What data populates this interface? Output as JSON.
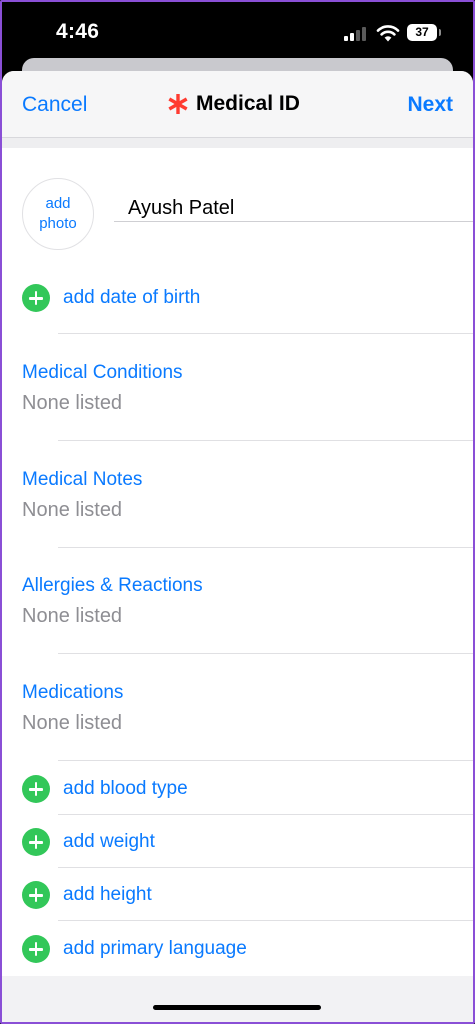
{
  "status_bar": {
    "time": "4:46",
    "battery": "37"
  },
  "nav": {
    "cancel_label": "Cancel",
    "title": "Medical ID",
    "next_label": "Next",
    "accent_color": "#0a7aff",
    "star_color": "#ff3b30"
  },
  "profile": {
    "add_photo_line1": "add",
    "add_photo_line2": "photo",
    "name": "Ayush Patel"
  },
  "add_date_of_birth": "add date of birth",
  "sections": [
    {
      "title": "Medical Conditions",
      "value": "None listed"
    },
    {
      "title": "Medical Notes",
      "value": "None listed"
    },
    {
      "title": "Allergies & Reactions",
      "value": "None listed"
    },
    {
      "title": "Medications",
      "value": "None listed"
    }
  ],
  "add_items": [
    {
      "label": "add blood type"
    },
    {
      "label": "add weight"
    },
    {
      "label": "add height"
    },
    {
      "label": "add primary language"
    }
  ],
  "icons": {
    "add": "plus-circle-icon",
    "title": "asterisk-icon"
  },
  "colors": {
    "add_green": "#32c759",
    "muted_text": "#8e8e93"
  }
}
